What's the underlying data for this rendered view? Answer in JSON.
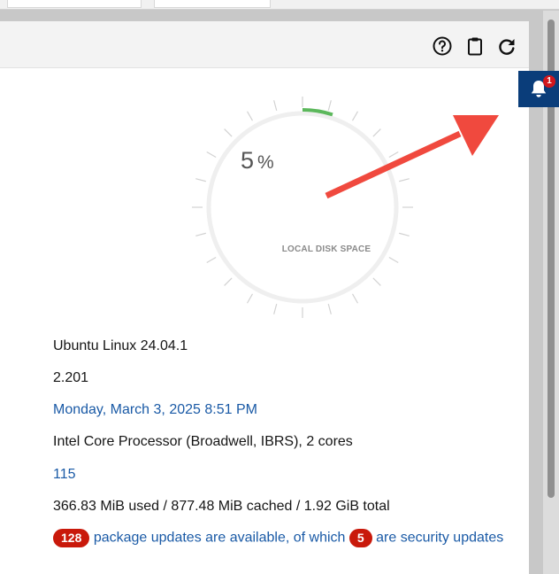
{
  "toolbar": {
    "help_icon": "help-circle-icon",
    "clipboard_icon": "clipboard-icon",
    "reload_icon": "reload-icon"
  },
  "notifications": {
    "icon": "bell-icon",
    "count": "1"
  },
  "disk_gauge": {
    "percent_value": "5",
    "percent_symbol": "%",
    "percent_used": 5,
    "label": "LOCAL DISK SPACE",
    "arc_color": "#5cb85c"
  },
  "system_info": {
    "os": "Ubuntu Linux 24.04.1",
    "version": "2.201",
    "datetime": "Monday, March 3, 2025 8:51 PM",
    "cpu": "Intel Core Processor (Broadwell, IBRS), 2 cores",
    "uptime_link": "115",
    "memory": "366.83 MiB used / 877.48 MiB cached / 1.92 GiB total",
    "updates": {
      "package_count": "128",
      "text_middle": "package updates are available, of which",
      "security_count": "5",
      "text_end": "are security updates"
    }
  },
  "colors": {
    "link": "#1a5aa6",
    "badge_red": "#c9190b",
    "bell_bg": "#0a3d7a",
    "annotation_arrow": "#f0493e"
  }
}
